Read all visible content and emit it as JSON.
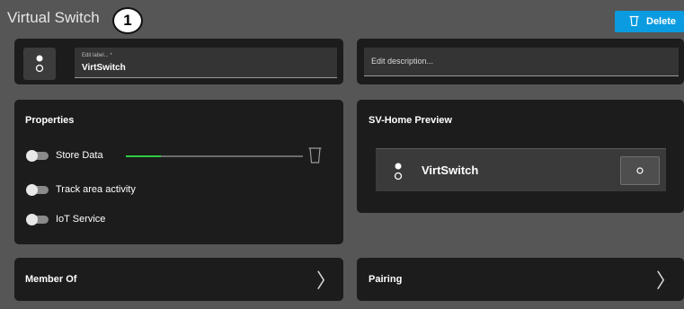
{
  "header": {
    "title": "Virtual Switch",
    "step_badge": "1",
    "delete_label": "Delete"
  },
  "label_field": {
    "label": "Edit label... *",
    "value": "VirtSwitch"
  },
  "description_field": {
    "placeholder": "Edit description..."
  },
  "properties": {
    "title": "Properties",
    "items": [
      {
        "label": "Store Data",
        "enabled": false
      },
      {
        "label": "Track area activity",
        "enabled": false
      },
      {
        "label": "IoT Service",
        "enabled": false
      }
    ],
    "store_data_progress": 0.2
  },
  "preview": {
    "title": "SV-Home Preview",
    "device_label": "VirtSwitch"
  },
  "member_of": {
    "title": "Member Of"
  },
  "pairing": {
    "title": "Pairing"
  },
  "colors": {
    "accent": "#0b9be0",
    "progress": "#2ecc40",
    "card_bg": "#1c1c1c",
    "page_bg": "#565656"
  },
  "icons": [
    "switch-icon",
    "trash-icon",
    "chevron-right-icon",
    "power-icon"
  ]
}
